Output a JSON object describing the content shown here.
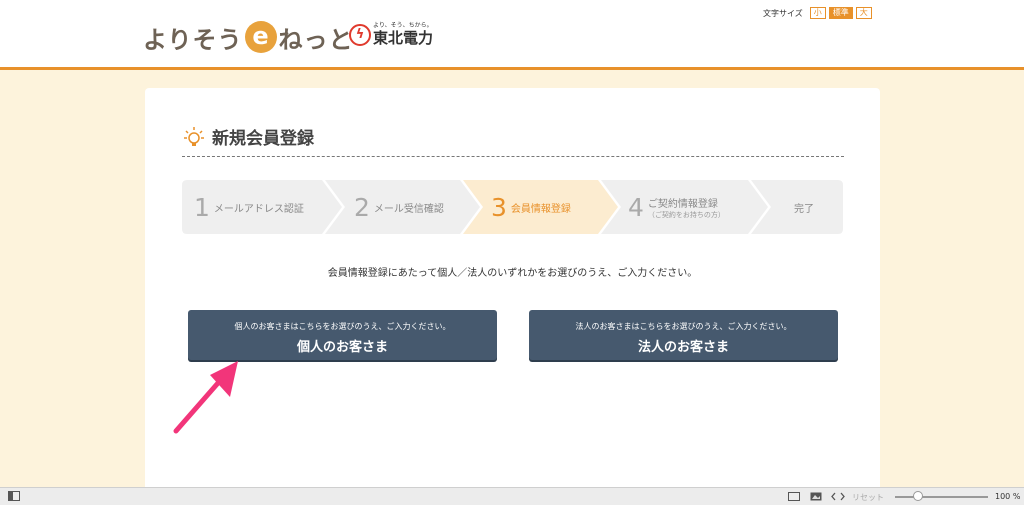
{
  "header": {
    "logo_part1": "よりそう",
    "logo_e": "e",
    "logo_part2": "ねっと",
    "company_tagline": "より、そう、ちから。",
    "company_name": "東北電力",
    "font_size_label": "文字サイズ",
    "font_sizes": [
      "小",
      "標準",
      "大"
    ],
    "font_size_selected": "標準"
  },
  "page": {
    "title": "新規会員登録",
    "instruction": "会員情報登録にあたって個人／法人のいずれかをお選びのうえ、ご入力ください。"
  },
  "steps": [
    {
      "num": "1",
      "label": "メールアドレス認証",
      "active": false
    },
    {
      "num": "2",
      "label": "メール受信確認",
      "active": false
    },
    {
      "num": "3",
      "label": "会員情報登録",
      "active": true
    },
    {
      "num": "4",
      "label": "ご契約情報登録",
      "sub": "（ご契約をお持ちの方）",
      "active": false
    },
    {
      "num": "",
      "label": "完了",
      "active": false
    }
  ],
  "choices": {
    "individual": {
      "sub": "個人のお客さまはこちらをお選びのうえ、ご入力ください。",
      "main": "個人のお客さま"
    },
    "corporate": {
      "sub": "法人のお客さまはこちらをお選びのうえ、ご入力ください。",
      "main": "法人のお客さま"
    }
  },
  "statusbar": {
    "reset_label": "リセット",
    "zoom": "100 %"
  },
  "colors": {
    "accent": "#e8912a",
    "button": "#46596e",
    "background": "#fdf3dc",
    "step_active": "#fcecd0",
    "step_inactive": "#efefef",
    "annotation_arrow": "#f2357a"
  }
}
